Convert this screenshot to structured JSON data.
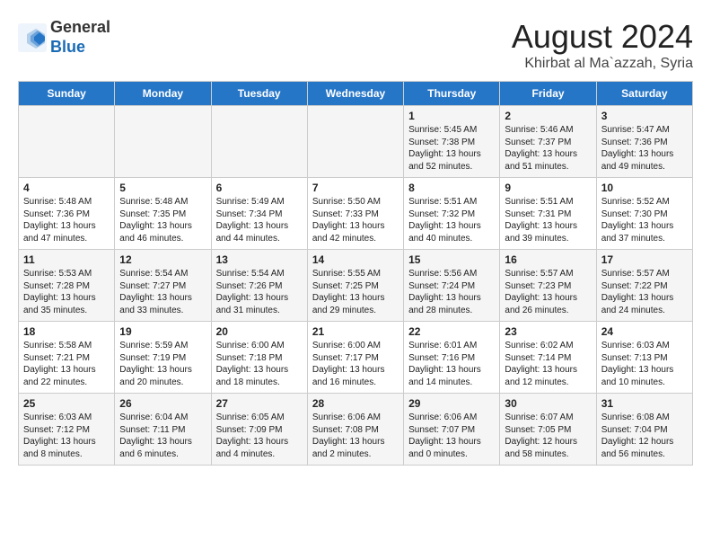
{
  "header": {
    "logo_line1": "General",
    "logo_line2": "Blue",
    "month_year": "August 2024",
    "location": "Khirbat al Ma`azzah, Syria"
  },
  "weekdays": [
    "Sunday",
    "Monday",
    "Tuesday",
    "Wednesday",
    "Thursday",
    "Friday",
    "Saturday"
  ],
  "weeks": [
    [
      {
        "day": "",
        "text": ""
      },
      {
        "day": "",
        "text": ""
      },
      {
        "day": "",
        "text": ""
      },
      {
        "day": "",
        "text": ""
      },
      {
        "day": "1",
        "text": "Sunrise: 5:45 AM\nSunset: 7:38 PM\nDaylight: 13 hours and 52 minutes."
      },
      {
        "day": "2",
        "text": "Sunrise: 5:46 AM\nSunset: 7:37 PM\nDaylight: 13 hours and 51 minutes."
      },
      {
        "day": "3",
        "text": "Sunrise: 5:47 AM\nSunset: 7:36 PM\nDaylight: 13 hours and 49 minutes."
      }
    ],
    [
      {
        "day": "4",
        "text": "Sunrise: 5:48 AM\nSunset: 7:36 PM\nDaylight: 13 hours and 47 minutes."
      },
      {
        "day": "5",
        "text": "Sunrise: 5:48 AM\nSunset: 7:35 PM\nDaylight: 13 hours and 46 minutes."
      },
      {
        "day": "6",
        "text": "Sunrise: 5:49 AM\nSunset: 7:34 PM\nDaylight: 13 hours and 44 minutes."
      },
      {
        "day": "7",
        "text": "Sunrise: 5:50 AM\nSunset: 7:33 PM\nDaylight: 13 hours and 42 minutes."
      },
      {
        "day": "8",
        "text": "Sunrise: 5:51 AM\nSunset: 7:32 PM\nDaylight: 13 hours and 40 minutes."
      },
      {
        "day": "9",
        "text": "Sunrise: 5:51 AM\nSunset: 7:31 PM\nDaylight: 13 hours and 39 minutes."
      },
      {
        "day": "10",
        "text": "Sunrise: 5:52 AM\nSunset: 7:30 PM\nDaylight: 13 hours and 37 minutes."
      }
    ],
    [
      {
        "day": "11",
        "text": "Sunrise: 5:53 AM\nSunset: 7:28 PM\nDaylight: 13 hours and 35 minutes."
      },
      {
        "day": "12",
        "text": "Sunrise: 5:54 AM\nSunset: 7:27 PM\nDaylight: 13 hours and 33 minutes."
      },
      {
        "day": "13",
        "text": "Sunrise: 5:54 AM\nSunset: 7:26 PM\nDaylight: 13 hours and 31 minutes."
      },
      {
        "day": "14",
        "text": "Sunrise: 5:55 AM\nSunset: 7:25 PM\nDaylight: 13 hours and 29 minutes."
      },
      {
        "day": "15",
        "text": "Sunrise: 5:56 AM\nSunset: 7:24 PM\nDaylight: 13 hours and 28 minutes."
      },
      {
        "day": "16",
        "text": "Sunrise: 5:57 AM\nSunset: 7:23 PM\nDaylight: 13 hours and 26 minutes."
      },
      {
        "day": "17",
        "text": "Sunrise: 5:57 AM\nSunset: 7:22 PM\nDaylight: 13 hours and 24 minutes."
      }
    ],
    [
      {
        "day": "18",
        "text": "Sunrise: 5:58 AM\nSunset: 7:21 PM\nDaylight: 13 hours and 22 minutes."
      },
      {
        "day": "19",
        "text": "Sunrise: 5:59 AM\nSunset: 7:19 PM\nDaylight: 13 hours and 20 minutes."
      },
      {
        "day": "20",
        "text": "Sunrise: 6:00 AM\nSunset: 7:18 PM\nDaylight: 13 hours and 18 minutes."
      },
      {
        "day": "21",
        "text": "Sunrise: 6:00 AM\nSunset: 7:17 PM\nDaylight: 13 hours and 16 minutes."
      },
      {
        "day": "22",
        "text": "Sunrise: 6:01 AM\nSunset: 7:16 PM\nDaylight: 13 hours and 14 minutes."
      },
      {
        "day": "23",
        "text": "Sunrise: 6:02 AM\nSunset: 7:14 PM\nDaylight: 13 hours and 12 minutes."
      },
      {
        "day": "24",
        "text": "Sunrise: 6:03 AM\nSunset: 7:13 PM\nDaylight: 13 hours and 10 minutes."
      }
    ],
    [
      {
        "day": "25",
        "text": "Sunrise: 6:03 AM\nSunset: 7:12 PM\nDaylight: 13 hours and 8 minutes."
      },
      {
        "day": "26",
        "text": "Sunrise: 6:04 AM\nSunset: 7:11 PM\nDaylight: 13 hours and 6 minutes."
      },
      {
        "day": "27",
        "text": "Sunrise: 6:05 AM\nSunset: 7:09 PM\nDaylight: 13 hours and 4 minutes."
      },
      {
        "day": "28",
        "text": "Sunrise: 6:06 AM\nSunset: 7:08 PM\nDaylight: 13 hours and 2 minutes."
      },
      {
        "day": "29",
        "text": "Sunrise: 6:06 AM\nSunset: 7:07 PM\nDaylight: 13 hours and 0 minutes."
      },
      {
        "day": "30",
        "text": "Sunrise: 6:07 AM\nSunset: 7:05 PM\nDaylight: 12 hours and 58 minutes."
      },
      {
        "day": "31",
        "text": "Sunrise: 6:08 AM\nSunset: 7:04 PM\nDaylight: 12 hours and 56 minutes."
      }
    ]
  ]
}
